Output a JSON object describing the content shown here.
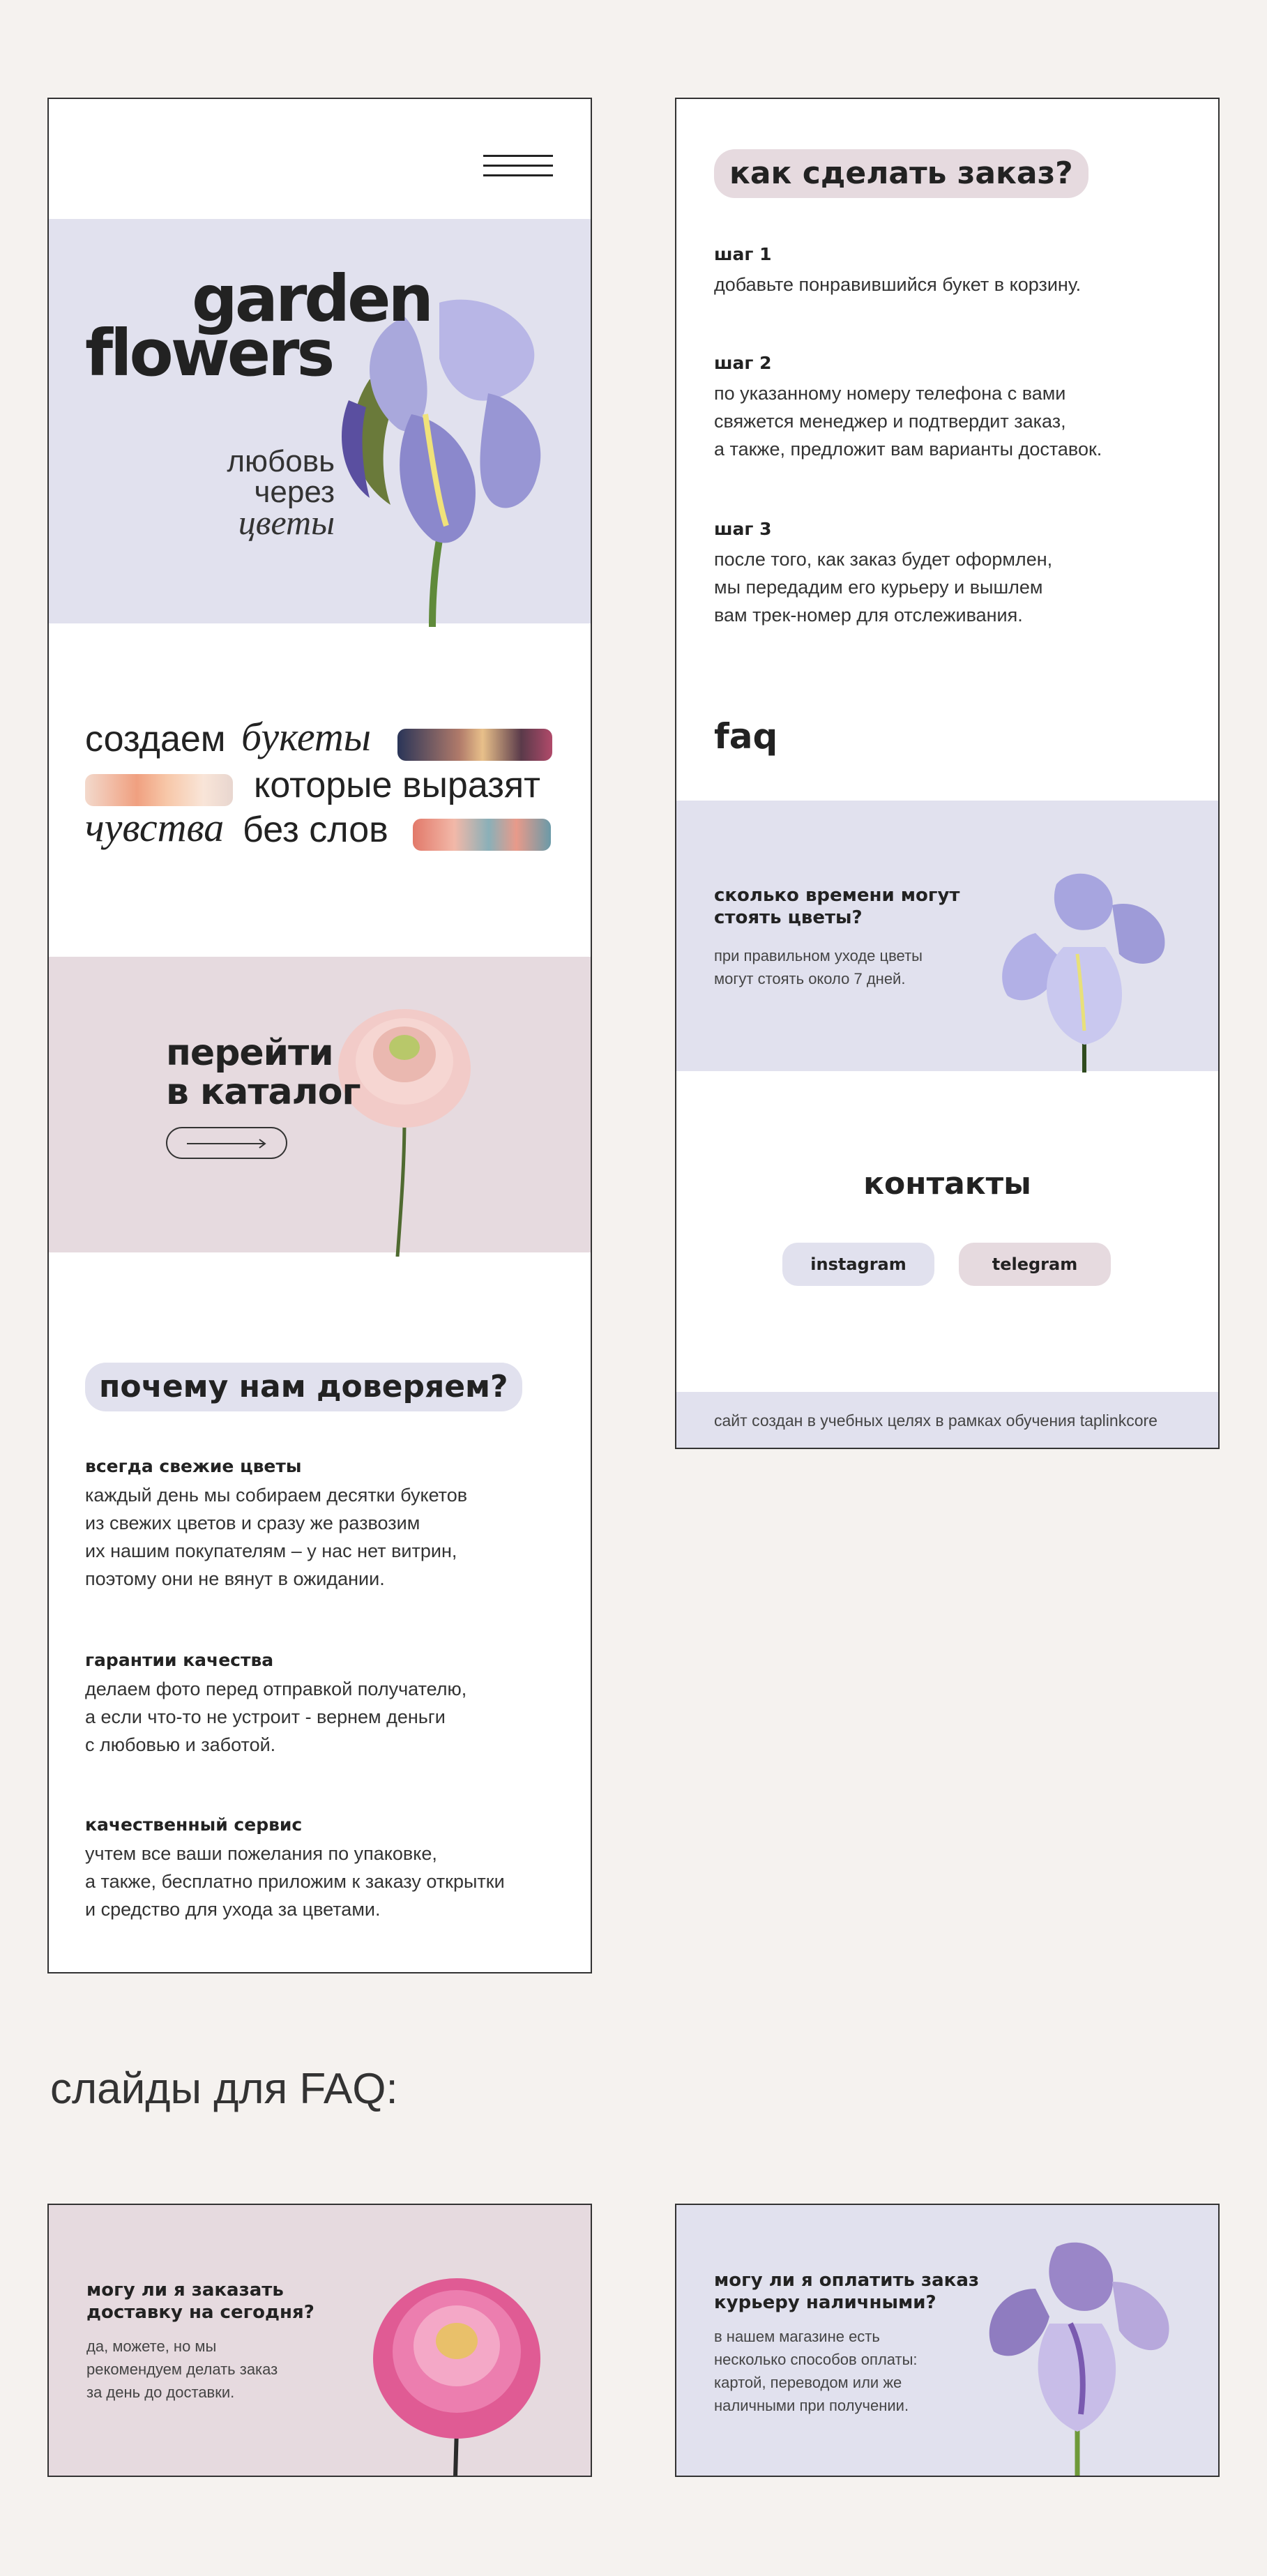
{
  "colors": {
    "background": "#f5f2ef",
    "lavender": "#e1e1ee",
    "blush": "#e6dadf",
    "text": "#222222"
  },
  "left_panel": {
    "menu_icon": "hamburger-menu-icon",
    "hero": {
      "title_line1": "garden",
      "title_line2": "flowers",
      "tagline_line1": "любовь",
      "tagline_line2": "через",
      "tagline_line3": "цветы"
    },
    "bouquets": {
      "line1_word1": "создаем",
      "line1_word2": "букеты",
      "line2": "которые выразят",
      "line3_word1": "чувства",
      "line3_word2": "без слов"
    },
    "catalog": {
      "line1": "перейти",
      "line2": "в каталог",
      "arrow_icon": "arrow-right-icon"
    },
    "trust": {
      "heading": "почему нам доверяем?",
      "items": [
        {
          "title": "всегда свежие цветы",
          "text": "каждый день мы собираем десятки букетов\nиз свежих цветов и сразу же развозим\nих нашим покупателям – у нас нет витрин,\nпоэтому они не вянут в ожидании."
        },
        {
          "title": "гарантии качества",
          "text": "делаем фото перед отправкой получателю,\nа если что-то не устроит - вернем деньги\nс любовью и заботой."
        },
        {
          "title": "качественный сервис",
          "text": "учтем все ваши пожелания по упаковке,\nа также, бесплатно приложим к заказу открытки\nи средство для ухода за цветами."
        }
      ]
    }
  },
  "right_panel": {
    "order": {
      "heading": "как сделать заказ?",
      "steps": [
        {
          "title": "шаг 1",
          "text": "добавьте понравившийся букет в корзину."
        },
        {
          "title": "шаг 2",
          "text": "по указанному номеру телефона с вами\nсвяжется менеджер и подтвердит заказ,\nа также, предложит вам варианты доставок."
        },
        {
          "title": "шаг 3",
          "text": "после того, как заказ будет оформлен,\nмы передадим его курьеру и вышлем\nвам трек-номер для отслеживания."
        }
      ]
    },
    "faq": {
      "heading": "faq",
      "question": "сколько времени могут\nстоять цветы?",
      "answer": "при правильном уходе цветы\nмогут стоять около 7 дней."
    },
    "contacts": {
      "heading": "контакты",
      "instagram_label": "instagram",
      "telegram_label": "telegram"
    },
    "footer_text": "сайт создан в учебных целях в рамках обучения taplinkcore"
  },
  "slides_caption": "слайды для FAQ:",
  "slides": [
    {
      "question": "могу ли я заказать\nдоставку на сегодня?",
      "answer": "да, можете, но мы\nрекомендуем делать заказ\nза день до доставки."
    },
    {
      "question": "могу ли я оплатить заказ\nкурьеру наличными?",
      "answer": "в нашем магазине есть\nнесколько способов оплаты:\nкартой, переводом или же\nналичными при получении."
    }
  ]
}
